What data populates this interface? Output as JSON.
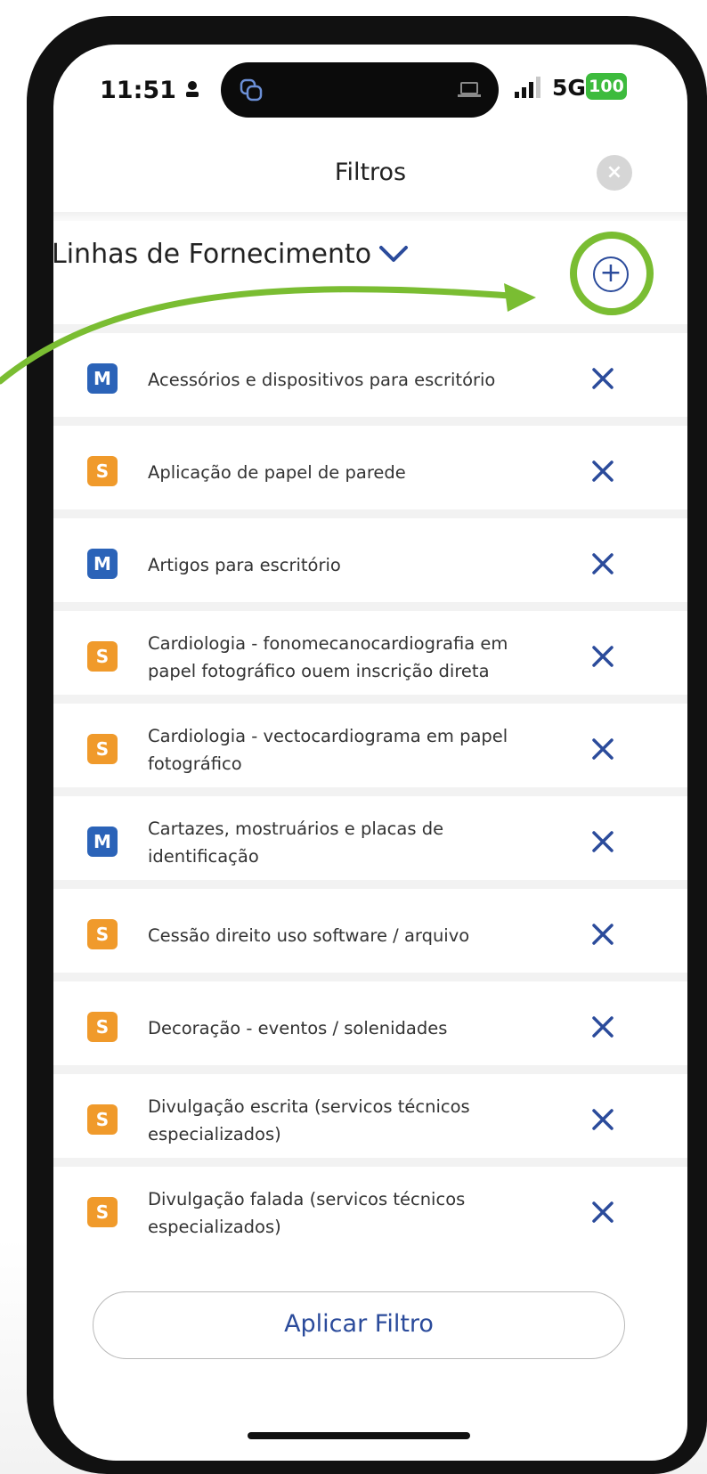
{
  "status_bar": {
    "time": "11:51",
    "network": "5G",
    "battery": "100"
  },
  "header": {
    "title": "Filtros",
    "close_label": "×"
  },
  "section": {
    "title": "Linhas de Fornecimento",
    "add_label": "+"
  },
  "items": [
    {
      "badge": "M",
      "label": "Acessórios e dispositivos para escritório"
    },
    {
      "badge": "S",
      "label": "Aplicação de papel de parede"
    },
    {
      "badge": "M",
      "label": "Artigos para escritório"
    },
    {
      "badge": "S",
      "label": "Cardiologia - fonomecanocardiografia em papel fotográfico ouem inscrição direta"
    },
    {
      "badge": "S",
      "label": "Cardiologia - vectocardiograma em papel fotográfico"
    },
    {
      "badge": "M",
      "label": "Cartazes, mostruários e placas de identificação"
    },
    {
      "badge": "S",
      "label": "Cessão direito uso software / arquivo"
    },
    {
      "badge": "S",
      "label": "Decoração - eventos / solenidades"
    },
    {
      "badge": "S",
      "label": "Divulgação escrita (servicos técnicos especializados)"
    },
    {
      "badge": "S",
      "label": "Divulgação falada (servicos técnicos especializados)"
    }
  ],
  "footer": {
    "apply_label": "Aplicar Filtro"
  },
  "colors": {
    "accent_blue": "#2b4b9b",
    "badge_m": "#2b63b8",
    "badge_s": "#f09a2b",
    "highlight_green": "#7abd32"
  },
  "icons": [
    "person-icon",
    "overlap-icon",
    "laptop-icon",
    "signal-icon",
    "close-icon",
    "chevron-down-icon",
    "plus-circle-icon",
    "remove-icon"
  ]
}
